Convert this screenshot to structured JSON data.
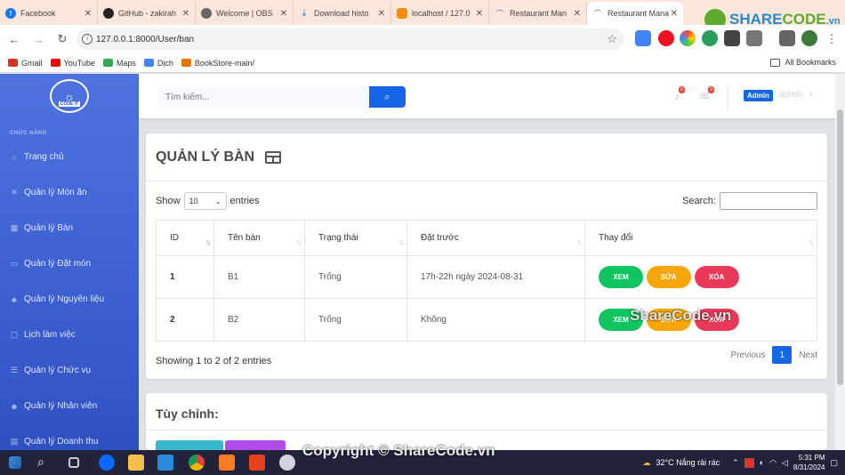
{
  "browser": {
    "tabs": [
      {
        "label": "Facebook",
        "color": "#1877f2"
      },
      {
        "label": "GitHub - zakirah",
        "color": "#222222"
      },
      {
        "label": "Welcome | OBS",
        "color": "#444444"
      },
      {
        "label": "Download histo",
        "color": "#1a73e8"
      },
      {
        "label": "localhost / 127.0",
        "color": "#f29111"
      },
      {
        "label": "Restaurant Man",
        "color": "#3c5fd0"
      },
      {
        "label": "Restaurant Mana",
        "color": "#3c5fd0"
      }
    ],
    "url": "127.0.0.1:8000/User/ban",
    "bookmarks": [
      "Gmail",
      "YouTube",
      "Maps",
      "Dịch",
      "BookStore-main/"
    ],
    "all_bookmarks": "All Bookmarks"
  },
  "branding": {
    "share": "SHARE",
    "code": "CODE",
    "suffix": ".vn"
  },
  "sidebar": {
    "logo_text": "CODE IT",
    "heading": "CHỨC NĂNG",
    "items": [
      {
        "label": "Trang chủ",
        "icon": "home-icon"
      },
      {
        "label": "Quản lý Món ăn",
        "icon": "utensils-icon"
      },
      {
        "label": "Quản lý Bàn",
        "icon": "table-icon"
      },
      {
        "label": "Quản lý Đặt món",
        "icon": "order-icon"
      },
      {
        "label": "Quản lý Nguyên liệu",
        "icon": "ingredient-icon"
      },
      {
        "label": "Lịch làm việc",
        "icon": "calendar-icon"
      },
      {
        "label": "Quản lý Chức vụ",
        "icon": "list-icon"
      },
      {
        "label": "Quản lý Nhân viên",
        "icon": "users-icon"
      },
      {
        "label": "Quản lý Doanh thu",
        "icon": "chart-icon"
      }
    ]
  },
  "topbar": {
    "search_placeholder": "Tìm kiếm...",
    "alerts_count": "0",
    "messages_count": "0",
    "role_badge": "Admin",
    "username": "admin"
  },
  "page": {
    "title": "QUẢN LÝ BÀN",
    "show_label": "Show",
    "entries_value": "10",
    "entries_label": "entries",
    "search_label": "Search:",
    "columns": [
      "ID",
      "Tên bàn",
      "Trạng thái",
      "Đặt trước",
      "Thay đổi"
    ],
    "rows": [
      {
        "id": "1",
        "name": "B1",
        "status": "Trống",
        "reservation": "17h-22h ngày 2024-08-31"
      },
      {
        "id": "2",
        "name": "B2",
        "status": "Trống",
        "reservation": "Không"
      }
    ],
    "actions": {
      "view": "XEM",
      "edit": "SỬA",
      "delete": "XÓA"
    },
    "info": "Showing 1 to 2 of 2 entries",
    "pager": {
      "previous": "Previous",
      "current": "1",
      "next": "Next"
    },
    "custom_title": "Tùy chỉnh:"
  },
  "watermarks": {
    "center": "ShareCode.vn",
    "footer": "Copyright © ShareCode.vn"
  },
  "taskbar": {
    "weather": "32°C  Nắng rải rác",
    "time": "5:31 PM",
    "date": "8/31/2024"
  }
}
